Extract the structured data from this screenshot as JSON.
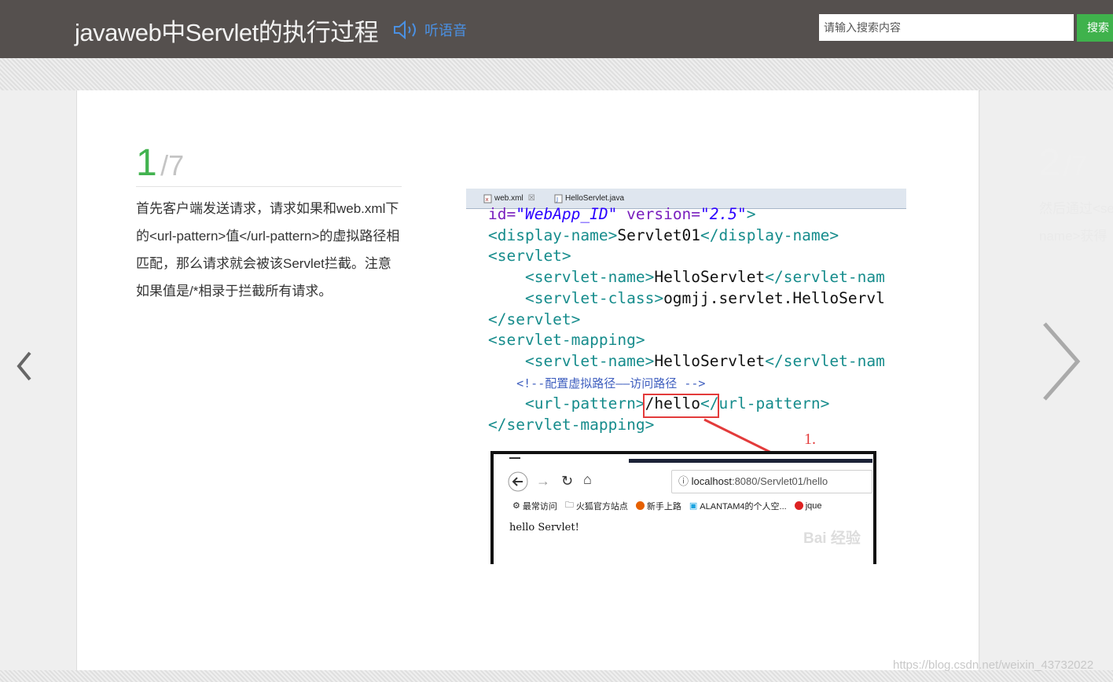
{
  "header": {
    "title": "javaweb中Servlet的执行过程",
    "listen_label": "听语音",
    "search_placeholder": "请输入搜索内容",
    "search_button": "搜索"
  },
  "step": {
    "current": "1",
    "total": "/7",
    "text": "首先客户端发送请求，请求如果和web.xml下的<url-pattern>值</url-pattern>的虚拟路径相匹配，那么请求就会被该Servlet拦截。注意如果值是/*相录于拦截所有请求。"
  },
  "next_step": {
    "current": "2",
    "total": "/7",
    "text_line1": "然后通过<se",
    "text_line2": "name>获得"
  },
  "screenshot": {
    "tabs": [
      "web.xml",
      "HelloServlet.java"
    ],
    "code": {
      "l0a": "id=",
      "l0b": "\"WebApp_ID\"",
      "l0c": " version=",
      "l0d": "\"2.5\"",
      "l0e": ">",
      "l1a": "<display-name>",
      "l1b": "Servlet01",
      "l1c": "</display-name>",
      "l2": "<servlet>",
      "l3a": "    <servlet-name>",
      "l3b": "HelloServlet",
      "l3c": "</servlet-nam",
      "l4a": "    <servlet-class>",
      "l4b": "ogmjj.servlet.HelloServl",
      "l5": "</servlet>",
      "l6": "<servlet-mapping>",
      "l7a": "    <servlet-name>",
      "l7b": "HelloServlet",
      "l7c": "</servlet-nam",
      "l8": "    <!--配置虚拟路径——访问路径 -->",
      "l9a": "    <url-pattern>",
      "l9b": "/hello",
      "l9c": "</url-pattern>",
      "l10": "</servlet-mapping>"
    },
    "annotation": "1.",
    "browser": {
      "url_host": "localhost",
      "url_rest": ":8080/Servlet01/hello",
      "bookmarks": [
        "最常访问",
        "火狐官方站点",
        "新手上路",
        "ALANTAM4的个人空...",
        "jque"
      ],
      "page_text": "hello Servlet!"
    }
  },
  "watermark": "https://blog.csdn.net/weixin_43732022",
  "colors": {
    "header_bg": "#55504e",
    "accent_green": "#42b34f",
    "link_blue": "#4a90e2",
    "annot_red": "#e33b3b"
  }
}
